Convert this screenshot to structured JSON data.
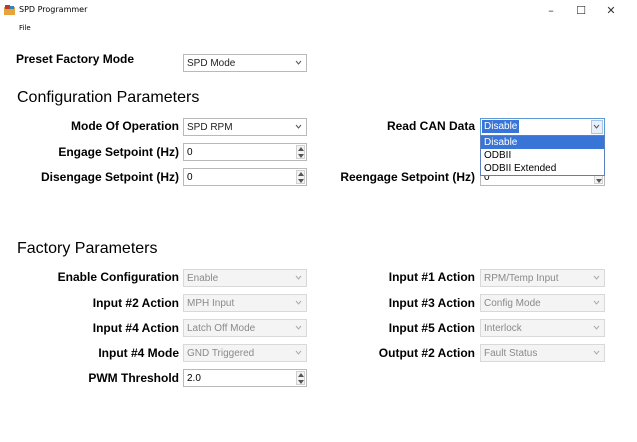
{
  "window": {
    "title": "SPD Programmer",
    "minimize_glyph": "–",
    "maximize_glyph": "☐",
    "close_glyph": "✕"
  },
  "menu": {
    "file_label": "File"
  },
  "preset": {
    "label": "Preset Factory Mode",
    "value": "SPD Mode"
  },
  "config": {
    "heading": "Configuration Parameters",
    "mode_label": "Mode Of Operation",
    "mode_value": "SPD RPM",
    "engage_label": "Engage Setpoint (Hz)",
    "engage_value": "0",
    "disengage_label": "Disengage Setpoint (Hz)",
    "disengage_value": "0",
    "read_can_label": "Read CAN Data",
    "read_can_value": "Disable",
    "read_can_options": [
      "Disable",
      "ODBII",
      "ODBII Extended"
    ],
    "reengage_label": "Reengage Setpoint (Hz)",
    "reengage_value": "0"
  },
  "factory": {
    "heading": "Factory Parameters",
    "enable_label": "Enable Configuration",
    "enable_value": "Enable",
    "input1_label": "Input #1 Action",
    "input1_value": "RPM/Temp Input",
    "input2_label": "Input #2 Action",
    "input2_value": "MPH Input",
    "input3_label": "Input #3 Action",
    "input3_value": "Config Mode",
    "input4_label": "Input #4 Action",
    "input4_value": "Latch Off Mode",
    "input5_label": "Input #5 Action",
    "input5_value": "Interlock",
    "input4mode_label": "Input #4 Mode",
    "input4mode_value": "GND Triggered",
    "output2_label": "Output #2 Action",
    "output2_value": "Fault Status",
    "pwm_label": "PWM Threshold",
    "pwm_value": "2.0"
  },
  "colors": {
    "accent": "#3875d7",
    "disabled_text": "#8a8a8a"
  }
}
